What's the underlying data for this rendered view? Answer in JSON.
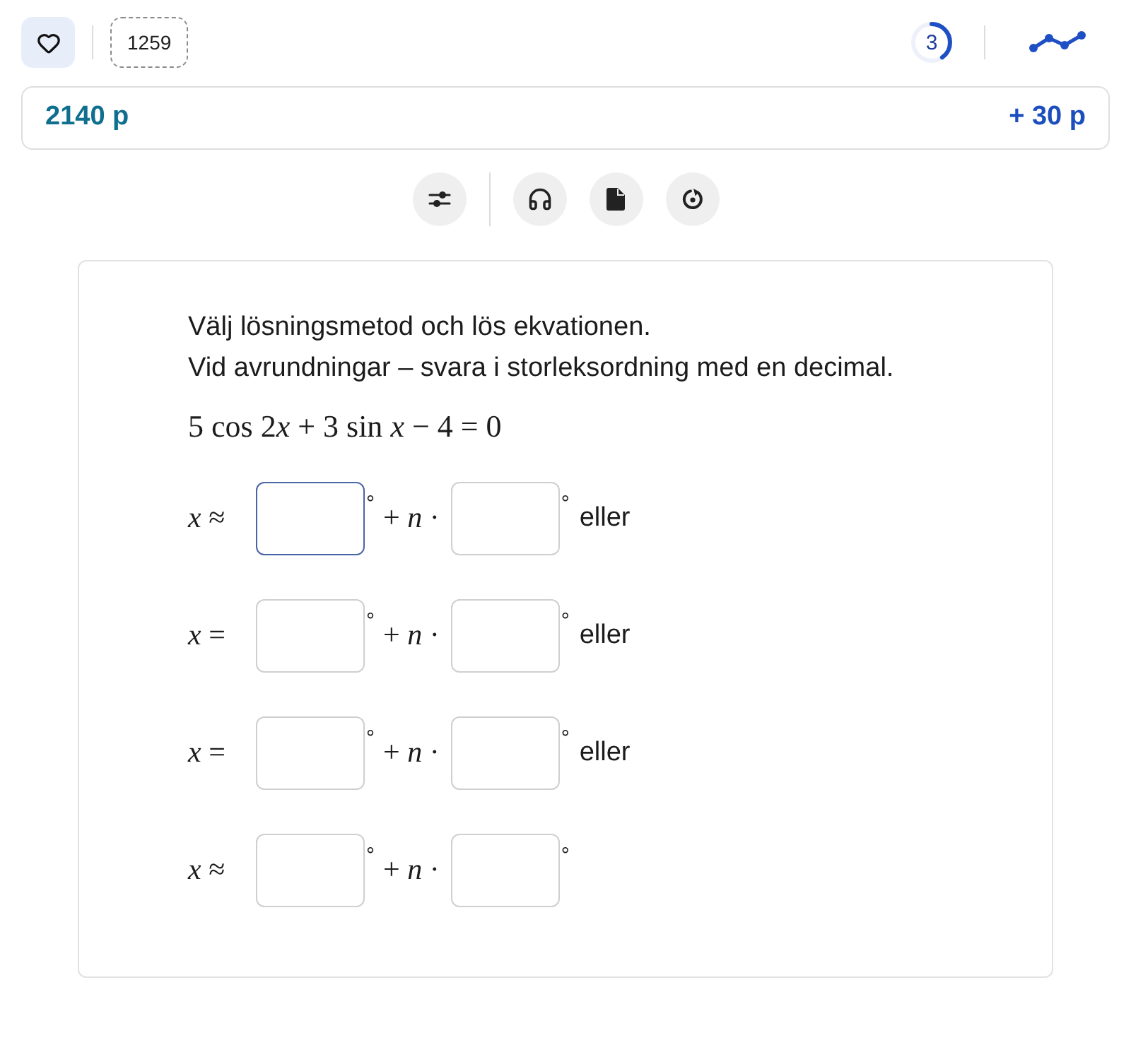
{
  "header": {
    "counter": "1259",
    "progress": {
      "value": "3",
      "level": 0.4
    }
  },
  "score_bar": {
    "total": "2140 p",
    "gain": "+ 30 p"
  },
  "task": {
    "instructions": [
      "Välj lösningsmetod och lös ekvationen.",
      "Vid avrundningar – svara i storleksordning med en decimal."
    ],
    "equation": [
      {
        "kind": "plain",
        "text": "5 cos 2"
      },
      {
        "kind": "variable",
        "text": "x"
      },
      {
        "kind": "plain",
        "text": " + 3 sin "
      },
      {
        "kind": "variable",
        "text": "x"
      },
      {
        "kind": "plain",
        "text": " − 4 = 0"
      }
    ],
    "rows": [
      {
        "relation": "*x* ≈",
        "fields": [
          {
            "focused": true,
            "unit": "°"
          },
          {
            "focused": false,
            "unit": "°"
          }
        ],
        "term": "+ *n* ·",
        "connector": "eller"
      },
      {
        "relation": "*x* =",
        "fields": [
          {
            "focused": false,
            "unit": "°"
          },
          {
            "focused": false,
            "unit": "°"
          }
        ],
        "term": "+ *n* ·",
        "connector": "eller"
      },
      {
        "relation": "*x* =",
        "fields": [
          {
            "focused": false,
            "unit": "°"
          },
          {
            "focused": false,
            "unit": "°"
          }
        ],
        "term": "+ *n* ·",
        "connector": "eller"
      },
      {
        "relation": "*x* ≈",
        "fields": [
          {
            "focused": false,
            "unit": "°"
          },
          {
            "focused": false,
            "unit": "°"
          }
        ],
        "term": "+ *n* ·"
      }
    ]
  }
}
